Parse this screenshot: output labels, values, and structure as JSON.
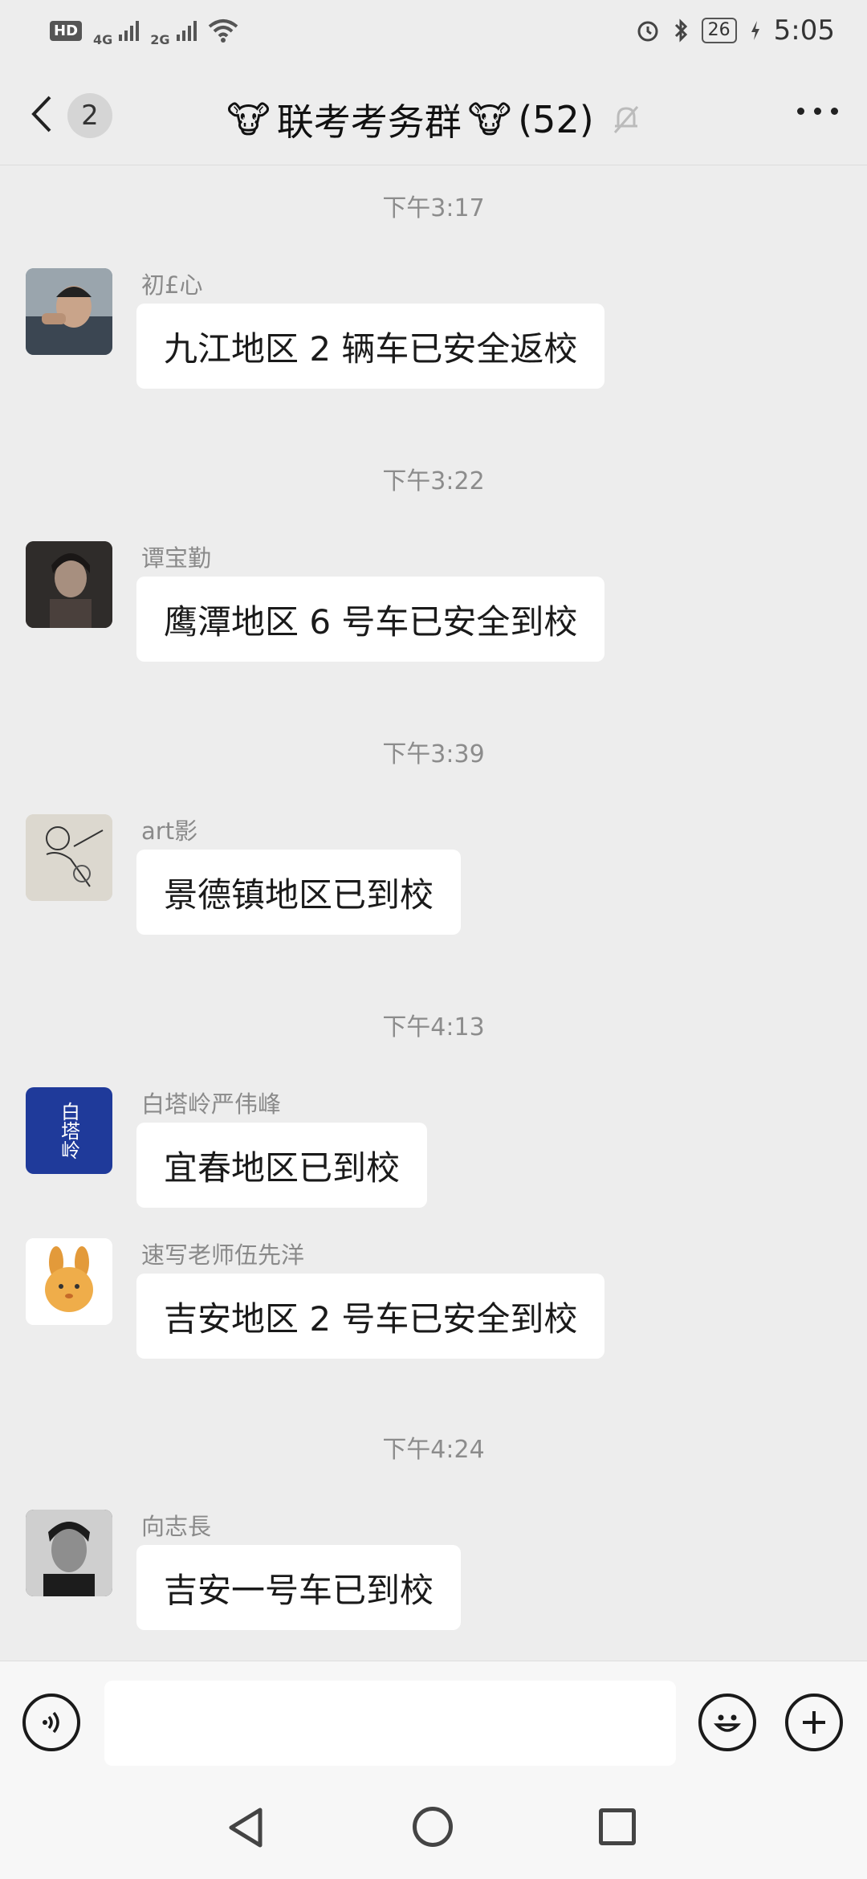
{
  "status_bar": {
    "hd": "HD",
    "net1": "4G",
    "net2": "2G",
    "battery": "26",
    "time": "5:05"
  },
  "header": {
    "unread_count": "2",
    "title_emoji_left": "🐮",
    "title_text": "联考考务群",
    "title_emoji_right": "🐮",
    "member_count": "(52)"
  },
  "messages": [
    {
      "timestamp": "下午3:17",
      "sender": "初£心",
      "text": "九江地区 2 辆车已安全返校",
      "avatar_color": "#7a8a99"
    },
    {
      "timestamp": "下午3:22",
      "sender": "谭宝勤",
      "text": "鹰潭地区 6 号车已安全到校",
      "avatar_color": "#3a3533"
    },
    {
      "timestamp": "下午3:39",
      "sender": "art影",
      "text": "景德镇地区已到校",
      "avatar_color": "#d8d4cc"
    },
    {
      "timestamp": "下午4:13",
      "sender": "白塔岭严伟峰",
      "text": "宜春地区已到校",
      "avatar_color": "#1f3a9a",
      "avatar_text": "白塔岭"
    },
    {
      "timestamp": "",
      "sender": "速写老师伍先洋",
      "text": "吉安地区 2 号车已安全到校",
      "avatar_color": "#ffffff"
    },
    {
      "timestamp": "下午4:24",
      "sender": "向志長",
      "text": "吉安一号车已到校",
      "avatar_color": "#2f2f2f"
    }
  ],
  "input": {
    "value": "",
    "placeholder": ""
  },
  "icons": {
    "back": "chevron-left-icon",
    "mute": "bell-muted-icon",
    "more": "more-dots-icon",
    "voice": "voice-icon",
    "emoji": "emoji-icon",
    "plus": "plus-icon"
  },
  "colors": {
    "background": "#ededed",
    "bubble": "#ffffff",
    "timestamp": "#8c8c8c"
  }
}
